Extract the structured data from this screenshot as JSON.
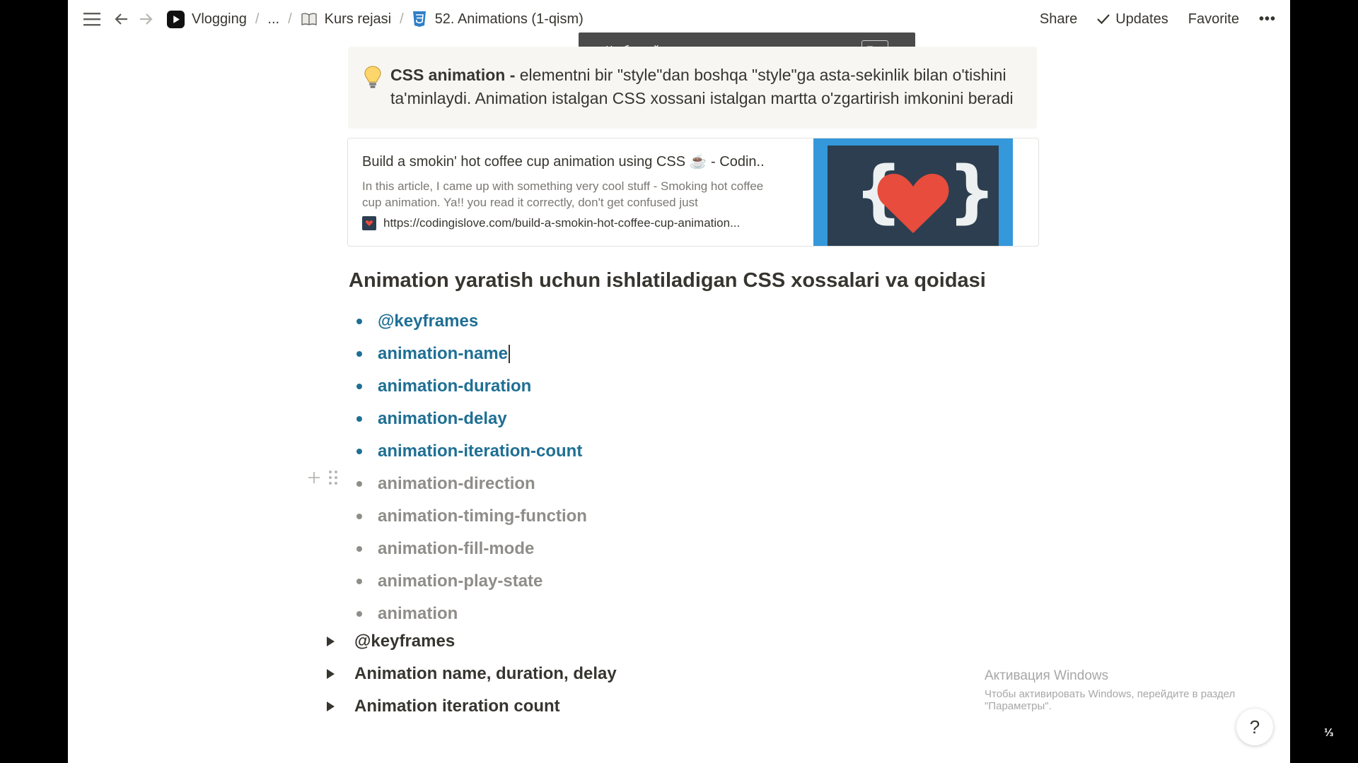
{
  "topbar": {
    "breadcrumbs": [
      {
        "label": "Vlogging",
        "icon": "youtube-icon"
      },
      {
        "label": "..."
      },
      {
        "label": "Kurs rejasi",
        "icon": "book-icon"
      },
      {
        "label": "52. Animations (1-qism)",
        "icon": "css3-icon"
      }
    ],
    "separator": "/",
    "share": "Share",
    "updates": "Updates",
    "favorite": "Favorite",
    "more": "•••"
  },
  "toast": {
    "text": "Чтобы выйти из полноэкранного режима, нажмите",
    "key": "Esc"
  },
  "callout": {
    "icon": "lightbulb-icon",
    "bold": "CSS animation -",
    "text": " elementni bir \"style\"dan boshqa \"style\"ga asta-sekinlik bilan o'tishini ta'minlaydi. Animation istalgan CSS xossani istalgan martta o'zgartirish imkonini beradi"
  },
  "bookmark": {
    "title": "Build a smokin' hot coffee cup animation using CSS ☕ - Codin...",
    "description": "In this article, I came up with something very cool stuff - Smoking hot coffee cup animation. Ya!! you read it correctly, don't get confused just",
    "url": "https://codingislove.com/build-a-smokin-hot-coffee-cup-animation..."
  },
  "heading": "Animation yaratish uchun ishlatiladigan CSS xossalari va qoidasi",
  "list": [
    {
      "label": "@keyframes",
      "state": "active"
    },
    {
      "label": "animation-name",
      "state": "active"
    },
    {
      "label": "animation-duration",
      "state": "active"
    },
    {
      "label": "animation-delay",
      "state": "active"
    },
    {
      "label": "animation-iteration-count",
      "state": "active"
    },
    {
      "label": "animation-direction",
      "state": "muted"
    },
    {
      "label": "animation-timing-function",
      "state": "muted"
    },
    {
      "label": "animation-fill-mode",
      "state": "muted"
    },
    {
      "label": "animation-play-state",
      "state": "muted"
    },
    {
      "label": "animation",
      "state": "muted"
    }
  ],
  "toggles": [
    {
      "label": "@keyframes"
    },
    {
      "label": "Animation name, duration, delay"
    },
    {
      "label": "Animation iteration count"
    }
  ],
  "watermark": {
    "title": "Активация Windows",
    "subtitle": "Чтобы активировать Windows, перейдите в раздел \"Параметры\"."
  },
  "help": "?",
  "corner_logo": "⅓",
  "colors": {
    "accent": "#1f6f94",
    "muted": "#8f8d89",
    "text": "#37352f"
  }
}
